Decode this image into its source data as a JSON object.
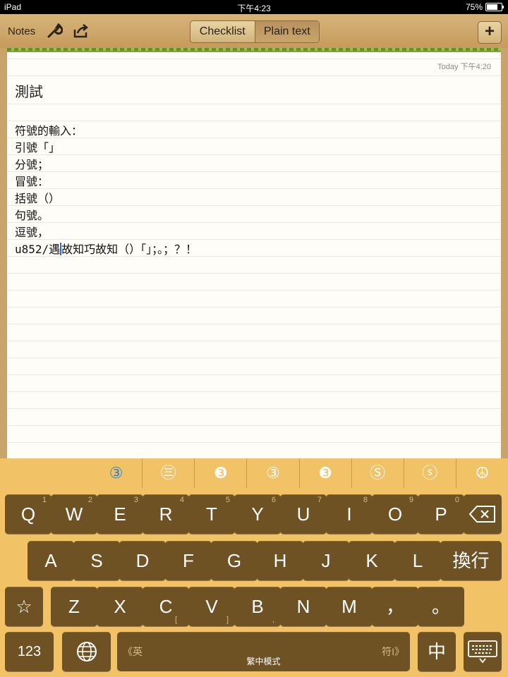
{
  "status_bar": {
    "device": "iPad",
    "time": "下午4:23",
    "battery": "75%",
    "battery_level": 0.75
  },
  "toolbar": {
    "notes_label": "Notes",
    "tabs": [
      {
        "label": "Checklist",
        "selected": false
      },
      {
        "label": "Plain text",
        "selected": true
      }
    ],
    "add_label": "+"
  },
  "note": {
    "timestamp": "Today 下午4:20",
    "title": "測試",
    "lines": [
      "符號的輸入：",
      "引號「」",
      "分號；",
      "冒號：",
      "括號（）",
      "句號。",
      "逗號，"
    ],
    "input_line_before": "u852/遇",
    "input_line_after": "故知巧故知（）「」；。；？！"
  },
  "keyboard": {
    "candidates": [
      "③",
      "㊂",
      "❸",
      "③",
      "❸",
      "Ⓢ",
      "ⓢ",
      "☮"
    ],
    "row1": [
      {
        "key": "Q",
        "num": "1"
      },
      {
        "key": "W",
        "num": "2"
      },
      {
        "key": "E",
        "num": "3"
      },
      {
        "key": "R",
        "num": "4"
      },
      {
        "key": "T",
        "num": "5"
      },
      {
        "key": "Y",
        "num": "6"
      },
      {
        "key": "U",
        "num": "7"
      },
      {
        "key": "I",
        "num": "8"
      },
      {
        "key": "O",
        "num": "9"
      },
      {
        "key": "P",
        "num": "0"
      }
    ],
    "row2": [
      "A",
      "S",
      "D",
      "F",
      "G",
      "H",
      "J",
      "K",
      "L"
    ],
    "return_label": "換行",
    "row3": [
      {
        "key": "Z",
        "sub": ""
      },
      {
        "key": "X",
        "sub": ""
      },
      {
        "key": "C",
        "sub": "["
      },
      {
        "key": "V",
        "sub": "]"
      },
      {
        "key": "B",
        "sub": ","
      },
      {
        "key": "N",
        "sub": ""
      },
      {
        "key": "M",
        "sub": ""
      }
    ],
    "star": "☆",
    "comma": "，",
    "period": "。",
    "numbers_label": "123",
    "space_left": "《英",
    "space_right": "符I》",
    "space_center": "繁中模式",
    "mode_label": "中"
  },
  "colors": {
    "accent_green": "#7fa33a",
    "key_brown": "#6e5224",
    "keyboard_bg": "#f1c266",
    "candidate_selected": "#2a80d8"
  }
}
